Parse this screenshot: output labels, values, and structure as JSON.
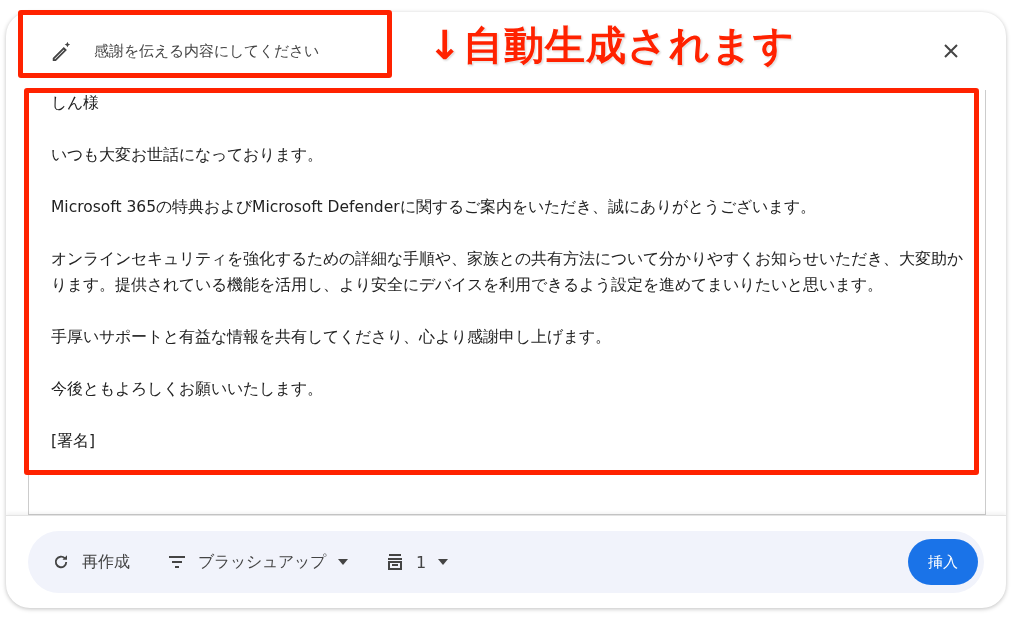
{
  "prompt": {
    "text": "感謝を伝える内容にしてください"
  },
  "callout": {
    "text": "↓自動生成されます"
  },
  "draft": {
    "paragraphs": [
      "しん様",
      "いつも大変お世話になっております。",
      "Microsoft 365の特典およびMicrosoft Defenderに関するご案内をいただき、誠にありがとうございます。",
      "オンラインセキュリティを強化するための詳細な手順や、家族との共有方法について分かりやすくお知らせいただき、大変助かります。提供されている機能を活用し、より安全にデバイスを利用できるよう設定を進めてまいりたいと思います。",
      "手厚いサポートと有益な情報を共有してくださり、心より感謝申し上げます。",
      "今後ともよろしくお願いいたします。",
      "[署名]"
    ]
  },
  "toolbar": {
    "recreate": "再作成",
    "refine": "ブラッシュアップ",
    "count": "1",
    "insert": "挿入"
  }
}
